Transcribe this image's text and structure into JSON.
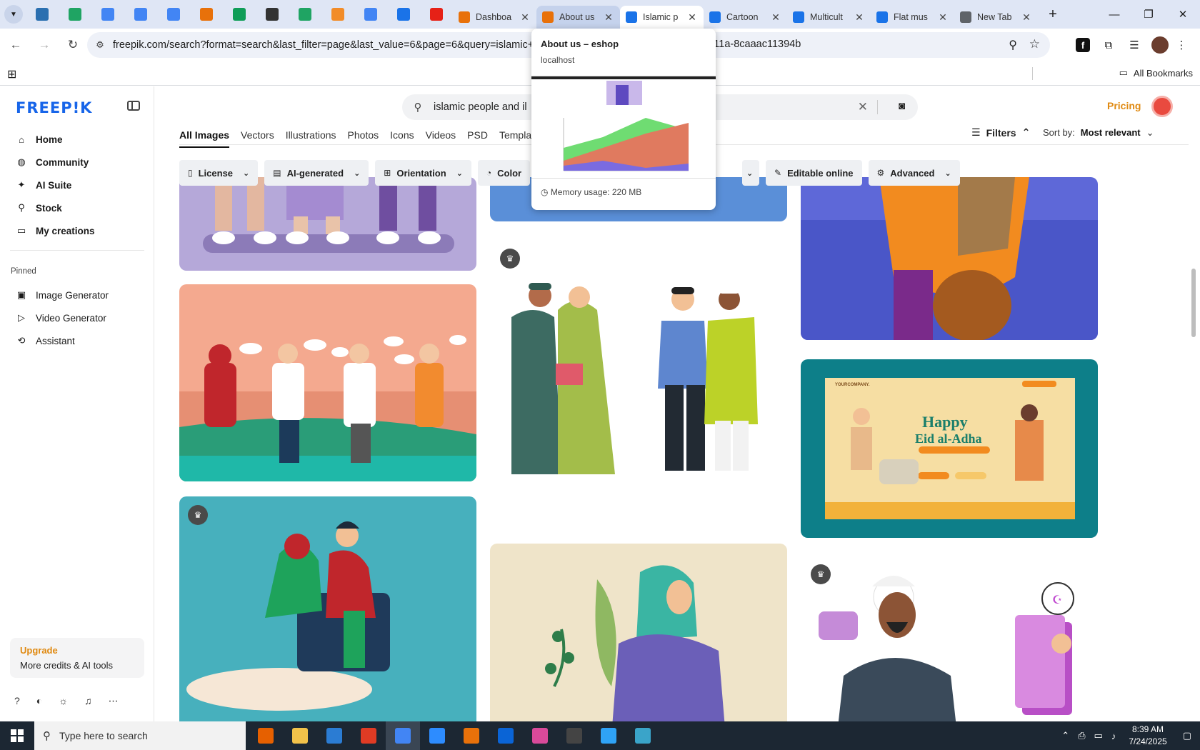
{
  "browser": {
    "pinned_colors": [
      "#2a6fb0",
      "#1fa463",
      "#4285f4",
      "#4285f4",
      "#4285f4",
      "#e8710a",
      "#0f9d58",
      "#333333",
      "#1fa463",
      "#f28c28",
      "#4285f4",
      "#1a73e8",
      "#e62117"
    ],
    "tabs": [
      {
        "label": "Dashboa",
        "color": "#e8710a",
        "state": "normal"
      },
      {
        "label": "About us",
        "color": "#e8710a",
        "state": "hover"
      },
      {
        "label": "Islamic p",
        "color": "#1a73e8",
        "state": "active"
      },
      {
        "label": "Cartoon",
        "color": "#1a73e8",
        "state": "normal"
      },
      {
        "label": "Multicult",
        "color": "#1a73e8",
        "state": "normal"
      },
      {
        "label": "Flat mus",
        "color": "#1a73e8",
        "state": "normal"
      },
      {
        "label": "New Tab",
        "color": "#5f6368",
        "state": "normal"
      }
    ],
    "url": "freepik.com/search?format=search&last_filter=page&last_value=6&page=6&query=islamic+pe",
    "url_tail": "bc-4e0b-911a-8caaac11394b",
    "bookmarks_label": "All Bookmarks"
  },
  "hovercard": {
    "title": "About us – eshop",
    "host": "localhost",
    "memory": "Memory usage: 220 MB"
  },
  "sidebar": {
    "logo": "FREEP!K",
    "nav": [
      {
        "label": "Home",
        "icon": "home-icon",
        "glyph": "⌂"
      },
      {
        "label": "Community",
        "icon": "globe-icon",
        "glyph": "◍"
      },
      {
        "label": "AI Suite",
        "icon": "sparkle-icon",
        "glyph": "✦"
      },
      {
        "label": "Stock",
        "icon": "search-icon",
        "glyph": "⚲"
      },
      {
        "label": "My creations",
        "icon": "folder-icon",
        "glyph": "▭"
      }
    ],
    "pinned_title": "Pinned",
    "pinned": [
      {
        "label": "Image Generator",
        "icon": "image-icon",
        "glyph": "▣"
      },
      {
        "label": "Video Generator",
        "icon": "video-icon",
        "glyph": "▷"
      },
      {
        "label": "Assistant",
        "icon": "assistant-icon",
        "glyph": "⟲"
      }
    ],
    "upgrade_title": "Upgrade",
    "upgrade_sub": "More credits & AI tools"
  },
  "main": {
    "search_value": "islamic people and il",
    "pricing": "Pricing",
    "type_tabs": [
      "All Images",
      "Vectors",
      "Illustrations",
      "Photos",
      "Icons",
      "Videos",
      "PSD",
      "Templa"
    ],
    "filters": "Filters",
    "sort_label": "Sort by:",
    "sort_value": "Most relevant",
    "chips": [
      {
        "label": "License",
        "icon": "license-icon",
        "glyph": "▯"
      },
      {
        "label": "AI-generated",
        "icon": "ai-icon",
        "glyph": "▤"
      },
      {
        "label": "Orientation",
        "icon": "orientation-icon",
        "glyph": "⊞"
      },
      {
        "label": "Color",
        "icon": "color-icon",
        "glyph": "◔"
      }
    ],
    "chip_editable": "Editable online",
    "chip_advanced": "Advanced"
  },
  "taskbar": {
    "search_placeholder": "Type here to search",
    "time": "8:39 AM",
    "date": "7/24/2025",
    "app_colors": [
      "#e66000",
      "#f2c24a",
      "#2b7cd3",
      "#e03b24",
      "#4285f4",
      "#2d8cff",
      "#e8710a",
      "#0a64d6",
      "#d94a9a",
      "#444444",
      "#2fa3f6",
      "#3aa4c9"
    ]
  }
}
